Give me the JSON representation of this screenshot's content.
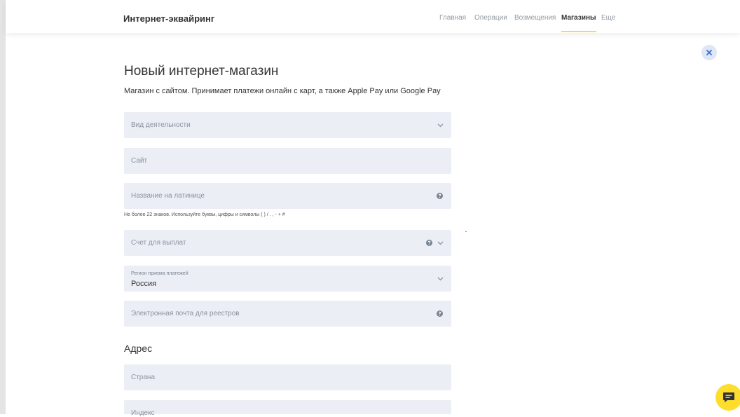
{
  "header": {
    "brand": "Интернет-эквайринг",
    "nav": [
      {
        "label": "Главная"
      },
      {
        "label": "Операции"
      },
      {
        "label": "Возмещения"
      },
      {
        "label": "Магазины",
        "active": true
      },
      {
        "label": "Еще"
      }
    ]
  },
  "form": {
    "title": "Новый интернет-магазин",
    "subtitle": "Магазин с сайтом. Принимает платежи онлайн с карт, а также Apple Pay или Google Pay",
    "fields": {
      "activity": {
        "placeholder": "Вид деятельности",
        "icon": "chevron-down-icon"
      },
      "site": {
        "placeholder": "Сайт"
      },
      "latin_name": {
        "placeholder": "Название на латинице",
        "icon": "help-icon",
        "hint": "Не более 22 знаков. Используйте буквы, цифры и символы ( ) / . , - + #"
      },
      "payout_account": {
        "placeholder": "Счет для выплат",
        "icons": [
          "help-icon",
          "chevron-down-icon"
        ]
      },
      "region": {
        "label": "Регион приема платежей",
        "value": "Россия",
        "icon": "chevron-down-icon"
      },
      "registry_email": {
        "placeholder": "Электронная почта для реестров",
        "icon": "help-icon"
      }
    },
    "address": {
      "title": "Адрес",
      "country": {
        "placeholder": "Страна"
      },
      "index": {
        "placeholder": "Индекс"
      }
    }
  },
  "colors": {
    "accent": "#ffdd2d",
    "field_bg": "#ebeef5",
    "close_bg": "#dfe6f4",
    "close_icon": "#3b6fd6"
  },
  "icons": {
    "close": "close-icon",
    "chat": "chat-icon"
  }
}
